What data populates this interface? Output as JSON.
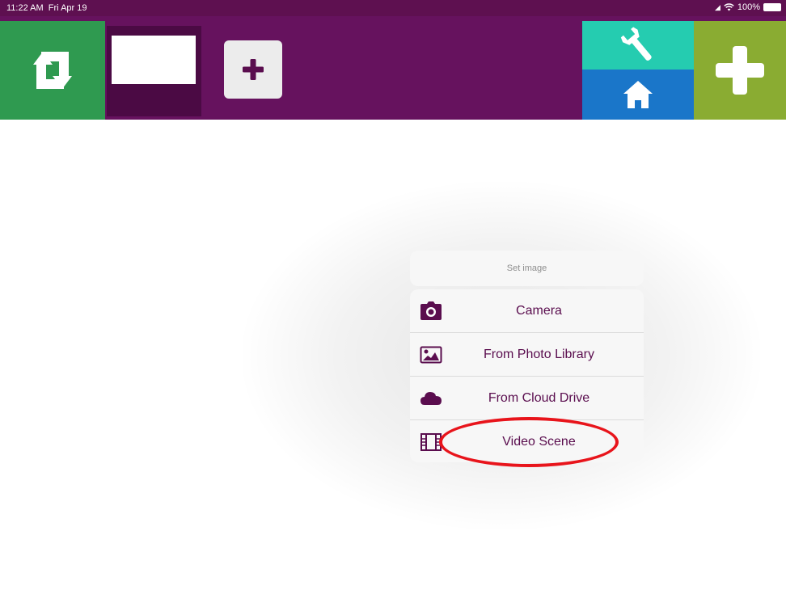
{
  "status_bar": {
    "time": "11:22 AM",
    "date": "Fri Apr 19",
    "battery": "100%",
    "icons": [
      "signal-icon",
      "wifi-icon",
      "battery-icon"
    ]
  },
  "toolbar": {
    "switch_icon": "swap-arrows-icon",
    "add_scene_icon": "plus-icon",
    "tools_icon": "wrench-icon",
    "home_icon": "home-icon",
    "add_icon": "plus-icon",
    "colors": {
      "toolbar": "#66125e",
      "switch": "#2f9a50",
      "tools": "#25ccb0",
      "home": "#1a76c9",
      "add": "#8aac32"
    }
  },
  "popover": {
    "title": "Set image",
    "items": [
      {
        "label": "Camera",
        "icon": "camera-icon"
      },
      {
        "label": "From Photo Library",
        "icon": "photo-icon"
      },
      {
        "label": "From Cloud Drive",
        "icon": "cloud-icon"
      },
      {
        "label": "Video Scene",
        "icon": "film-icon",
        "highlighted": true
      }
    ]
  },
  "annotation": {
    "shape": "red-ellipse",
    "color": "#e8141b",
    "target": "Video Scene"
  }
}
